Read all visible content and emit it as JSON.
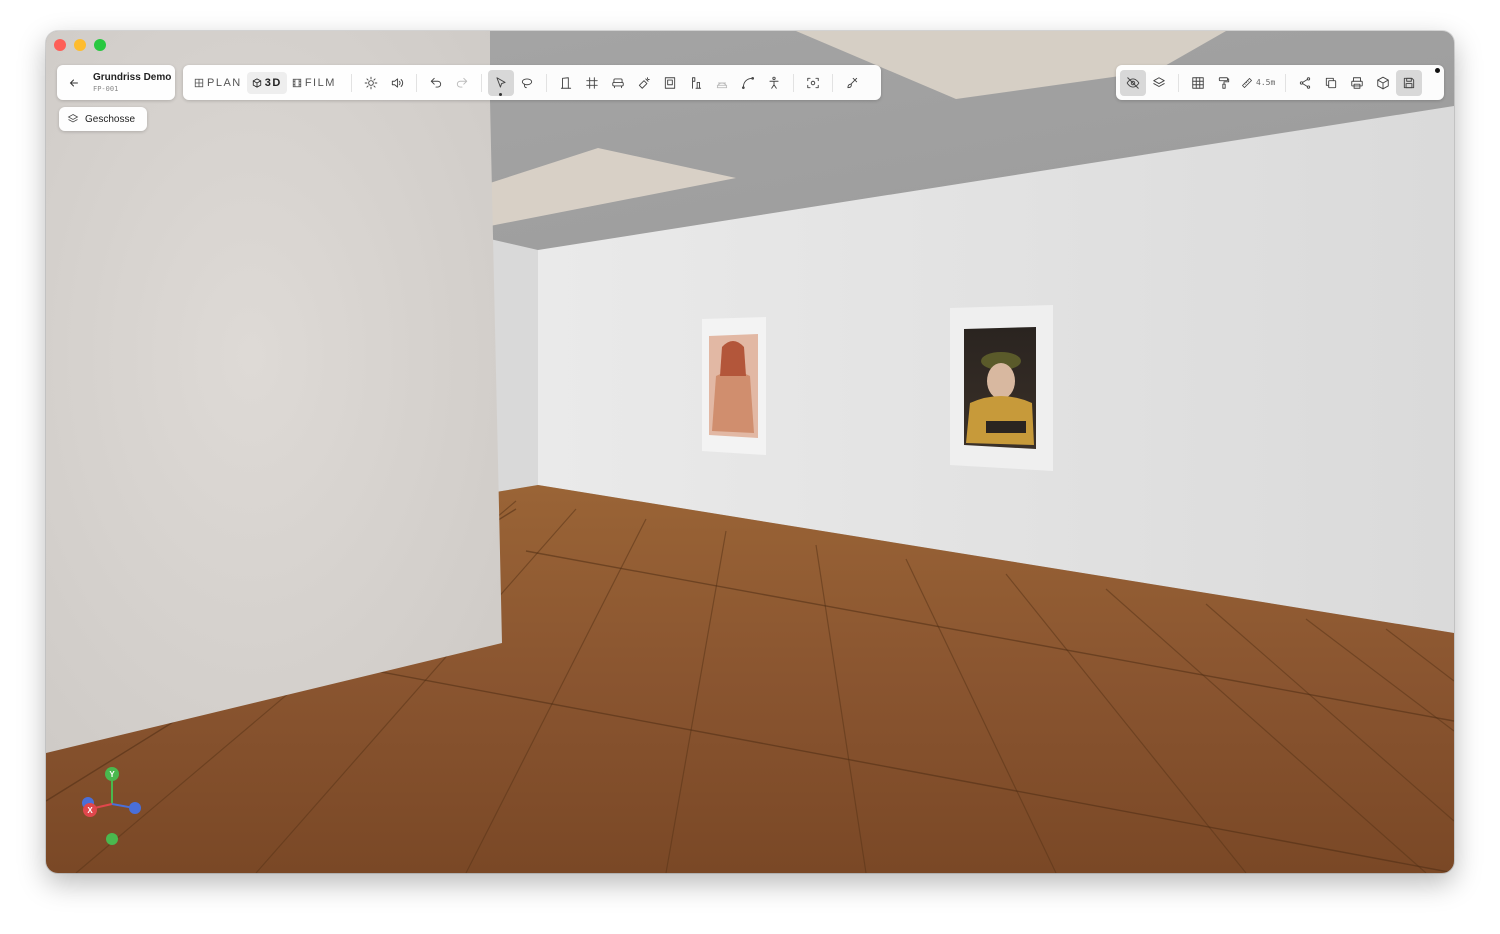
{
  "window": {
    "controls": [
      "close",
      "minimize",
      "zoom"
    ]
  },
  "project": {
    "name": "Grundriss Demo",
    "code": "FP-001",
    "back_icon": "arrow-left-icon"
  },
  "view_modes": [
    {
      "label": "PLAN",
      "icon": "grid-icon",
      "active": false
    },
    {
      "label": "3D",
      "icon": "cube-icon",
      "active": true
    },
    {
      "label": "FILM",
      "icon": "film-icon",
      "active": false
    }
  ],
  "toolbar": {
    "tools": [
      "light-icon",
      "sound-icon",
      "undo-icon",
      "redo-icon",
      "select-cursor-icon",
      "lasso-icon",
      "door-icon",
      "grid-hash-icon",
      "seat-icon",
      "spray-icon",
      "frame-icon",
      "sculpture-icon",
      "gradient-icon",
      "curve-icon",
      "person-icon",
      "camera-focus-icon",
      "brush-icon"
    ],
    "active_tool": "select-cursor-icon"
  },
  "right_toolbar": {
    "measure_value": "4.5m",
    "tools": [
      "eye-off-icon",
      "layers-icon",
      "table-icon",
      "paint-roller-icon",
      "ruler-icon",
      "share-icon",
      "copy-icon",
      "print-icon",
      "box-3d-icon",
      "save-icon"
    ],
    "active_tools": [
      "eye-off-icon",
      "save-icon"
    ]
  },
  "floors_button": {
    "label": "Geschosse",
    "icon": "layers-icon"
  },
  "gizmo": {
    "x_label": "X",
    "y_label": "Y",
    "colors": {
      "x": "#e0474c",
      "y": "#4ab84e",
      "z": "#4a6fd8"
    }
  },
  "colors": {
    "floor": "#8b5a30",
    "wall": "#e6e6e6",
    "ceiling": "#9c9c9c",
    "skylight": "#d8d0c6"
  }
}
